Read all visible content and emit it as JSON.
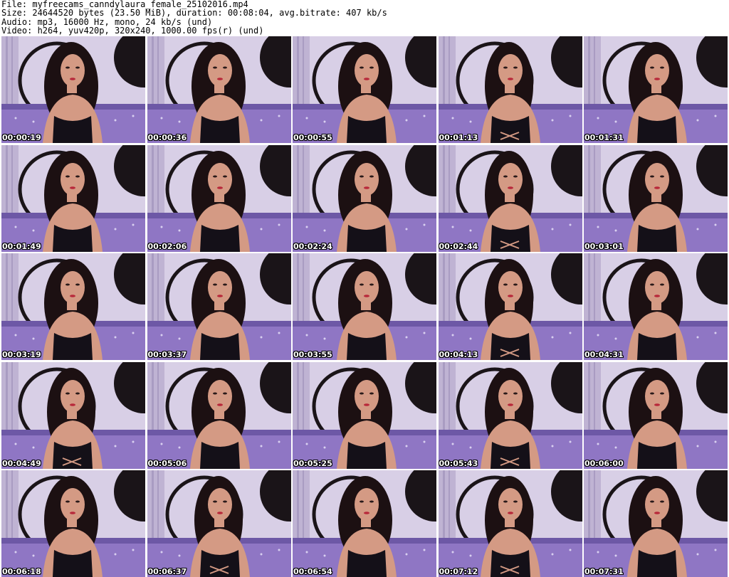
{
  "header": {
    "file": "File: myfreecams_canndylaura_female_25102016.mp4",
    "size": "Size: 24644520 bytes (23.50 MiB), duration: 00:08:04, avg.bitrate: 407 kb/s",
    "audio": "Audio: mp3, 16000 Hz, mono, 24 kb/s (und)",
    "video": "Video: h264, yuv420p, 320x240, 1000.00 fps(r) (und)"
  },
  "thumbnails": [
    {
      "timestamp": "00:00:19"
    },
    {
      "timestamp": "00:00:36"
    },
    {
      "timestamp": "00:00:55"
    },
    {
      "timestamp": "00:01:13"
    },
    {
      "timestamp": "00:01:31"
    },
    {
      "timestamp": "00:01:49"
    },
    {
      "timestamp": "00:02:06"
    },
    {
      "timestamp": "00:02:24"
    },
    {
      "timestamp": "00:02:44"
    },
    {
      "timestamp": "00:03:01"
    },
    {
      "timestamp": "00:03:19"
    },
    {
      "timestamp": "00:03:37"
    },
    {
      "timestamp": "00:03:55"
    },
    {
      "timestamp": "00:04:13"
    },
    {
      "timestamp": "00:04:31"
    },
    {
      "timestamp": "00:04:49"
    },
    {
      "timestamp": "00:05:06"
    },
    {
      "timestamp": "00:05:25"
    },
    {
      "timestamp": "00:05:43"
    },
    {
      "timestamp": "00:06:00"
    },
    {
      "timestamp": "00:06:18"
    },
    {
      "timestamp": "00:06:37"
    },
    {
      "timestamp": "00:06:54"
    },
    {
      "timestamp": "00:07:12"
    },
    {
      "timestamp": "00:07:31"
    }
  ],
  "colors": {
    "wall": "#d8cfe6",
    "sofa": "#8f76c4",
    "sofa_dark": "#6d58a6",
    "disc": "#1a1418",
    "hair": "#1c1012",
    "skin": "#d49a84",
    "outfit": "#141018"
  }
}
